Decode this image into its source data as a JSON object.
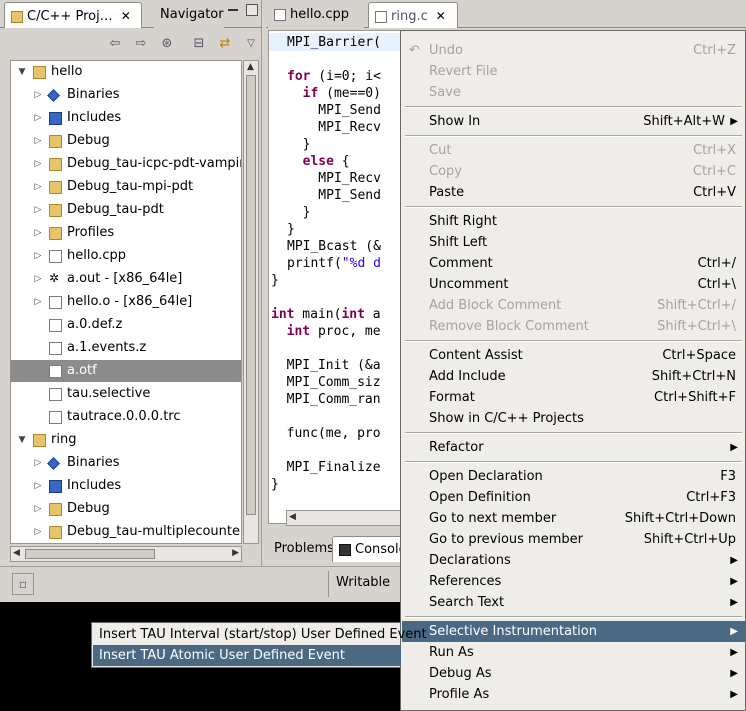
{
  "left_panel": {
    "tabs": [
      {
        "label": "C/C++ Proj…",
        "active": true
      },
      {
        "label": "Navigator",
        "active": false
      }
    ],
    "tree": [
      {
        "label": "hello",
        "kind": "project",
        "expanded": true
      },
      {
        "label": "Binaries",
        "kind": "binaries"
      },
      {
        "label": "Includes",
        "kind": "includes"
      },
      {
        "label": "Debug",
        "kind": "folder"
      },
      {
        "label": "Debug_tau-icpc-pdt-vampirtrac",
        "kind": "folder"
      },
      {
        "label": "Debug_tau-mpi-pdt",
        "kind": "folder"
      },
      {
        "label": "Debug_tau-pdt",
        "kind": "folder"
      },
      {
        "label": "Profiles",
        "kind": "folder"
      },
      {
        "label": "hello.cpp",
        "kind": "cfile"
      },
      {
        "label": "a.out - [x86_64le]",
        "kind": "exe"
      },
      {
        "label": "hello.o - [x86_64le]",
        "kind": "obj"
      },
      {
        "label": "a.0.def.z",
        "kind": "file"
      },
      {
        "label": "a.1.events.z",
        "kind": "file"
      },
      {
        "label": "a.otf",
        "kind": "file",
        "selected": true
      },
      {
        "label": "tau.selective",
        "kind": "file"
      },
      {
        "label": "tautrace.0.0.0.trc",
        "kind": "file"
      },
      {
        "label": "ring",
        "kind": "project",
        "expanded": true
      },
      {
        "label": "Binaries",
        "kind": "binaries"
      },
      {
        "label": "Includes",
        "kind": "includes"
      },
      {
        "label": "Debug",
        "kind": "folder"
      },
      {
        "label": "Debug_tau-multiplecounters-m",
        "kind": "folder"
      }
    ]
  },
  "editor": {
    "tabs": [
      {
        "label": "hello.cpp",
        "active": false
      },
      {
        "label": "ring.c",
        "active": true
      }
    ],
    "code_lines": [
      "MPI_Barrier(",
      "",
      "for (i=0; i<",
      "  if (me==0)",
      "    MPI_Send",
      "    MPI_Recv",
      "  }",
      "  else {",
      "    MPI_Recv",
      "    MPI_Send",
      "  }",
      "}",
      "MPI_Bcast (&",
      "printf(\"%d d",
      "}",
      "",
      "int main(int a",
      "  int proc, me",
      "",
      "  MPI_Init (&a",
      "  MPI_Comm_siz",
      "  MPI_Comm_ran",
      "",
      "  func(me, pro",
      "",
      "  MPI_Finalize",
      "}"
    ]
  },
  "bottom_panel": {
    "tabs": [
      "Problems",
      "Console"
    ]
  },
  "status_bar": {
    "mode": "Writable"
  },
  "context_menu": {
    "items": [
      {
        "label": "Undo",
        "accel": "Ctrl+Z",
        "disabled": true
      },
      {
        "label": "Revert File",
        "disabled": true
      },
      {
        "label": "Save",
        "disabled": true
      },
      {
        "sep": true
      },
      {
        "label": "Show In",
        "accel": "Shift+Alt+W",
        "submenu": true
      },
      {
        "sep": true
      },
      {
        "label": "Cut",
        "accel": "Ctrl+X",
        "disabled": true
      },
      {
        "label": "Copy",
        "accel": "Ctrl+C",
        "disabled": true
      },
      {
        "label": "Paste",
        "accel": "Ctrl+V"
      },
      {
        "sep": true
      },
      {
        "label": "Shift Right"
      },
      {
        "label": "Shift Left"
      },
      {
        "label": "Comment",
        "accel": "Ctrl+/"
      },
      {
        "label": "Uncomment",
        "accel": "Ctrl+\\"
      },
      {
        "label": "Add Block Comment",
        "accel": "Shift+Ctrl+/",
        "disabled": true
      },
      {
        "label": "Remove Block Comment",
        "accel": "Shift+Ctrl+\\",
        "disabled": true
      },
      {
        "sep": true
      },
      {
        "label": "Content Assist",
        "accel": "Ctrl+Space"
      },
      {
        "label": "Add Include",
        "accel": "Shift+Ctrl+N"
      },
      {
        "label": "Format",
        "accel": "Ctrl+Shift+F"
      },
      {
        "label": "Show in C/C++ Projects"
      },
      {
        "sep": true
      },
      {
        "label": "Refactor",
        "submenu": true
      },
      {
        "sep": true
      },
      {
        "label": "Open Declaration",
        "accel": "F3"
      },
      {
        "label": "Open Definition",
        "accel": "Ctrl+F3"
      },
      {
        "label": "Go to next member",
        "accel": "Shift+Ctrl+Down"
      },
      {
        "label": "Go to previous member",
        "accel": "Shift+Ctrl+Up"
      },
      {
        "label": "Declarations",
        "submenu": true
      },
      {
        "label": "References",
        "submenu": true
      },
      {
        "label": "Search Text",
        "submenu": true
      },
      {
        "sep": true
      },
      {
        "label": "Selective Instrumentation",
        "submenu": true,
        "highlighted": true
      },
      {
        "label": "Run As",
        "submenu": true
      },
      {
        "label": "Debug As",
        "submenu": true
      },
      {
        "label": "Profile As",
        "submenu": true
      }
    ]
  },
  "submenu": {
    "items": [
      {
        "label": "Insert TAU Interval (start/stop) User Defined Event",
        "highlighted": false
      },
      {
        "label": "Insert TAU Atomic User Defined Event",
        "highlighted": true
      }
    ]
  },
  "colors": {
    "selection": "#4b6983",
    "panel_bg": "#d6d3ce",
    "menu_bg": "#efede9",
    "keyword": "#7f0055",
    "string": "#2a00ff"
  }
}
